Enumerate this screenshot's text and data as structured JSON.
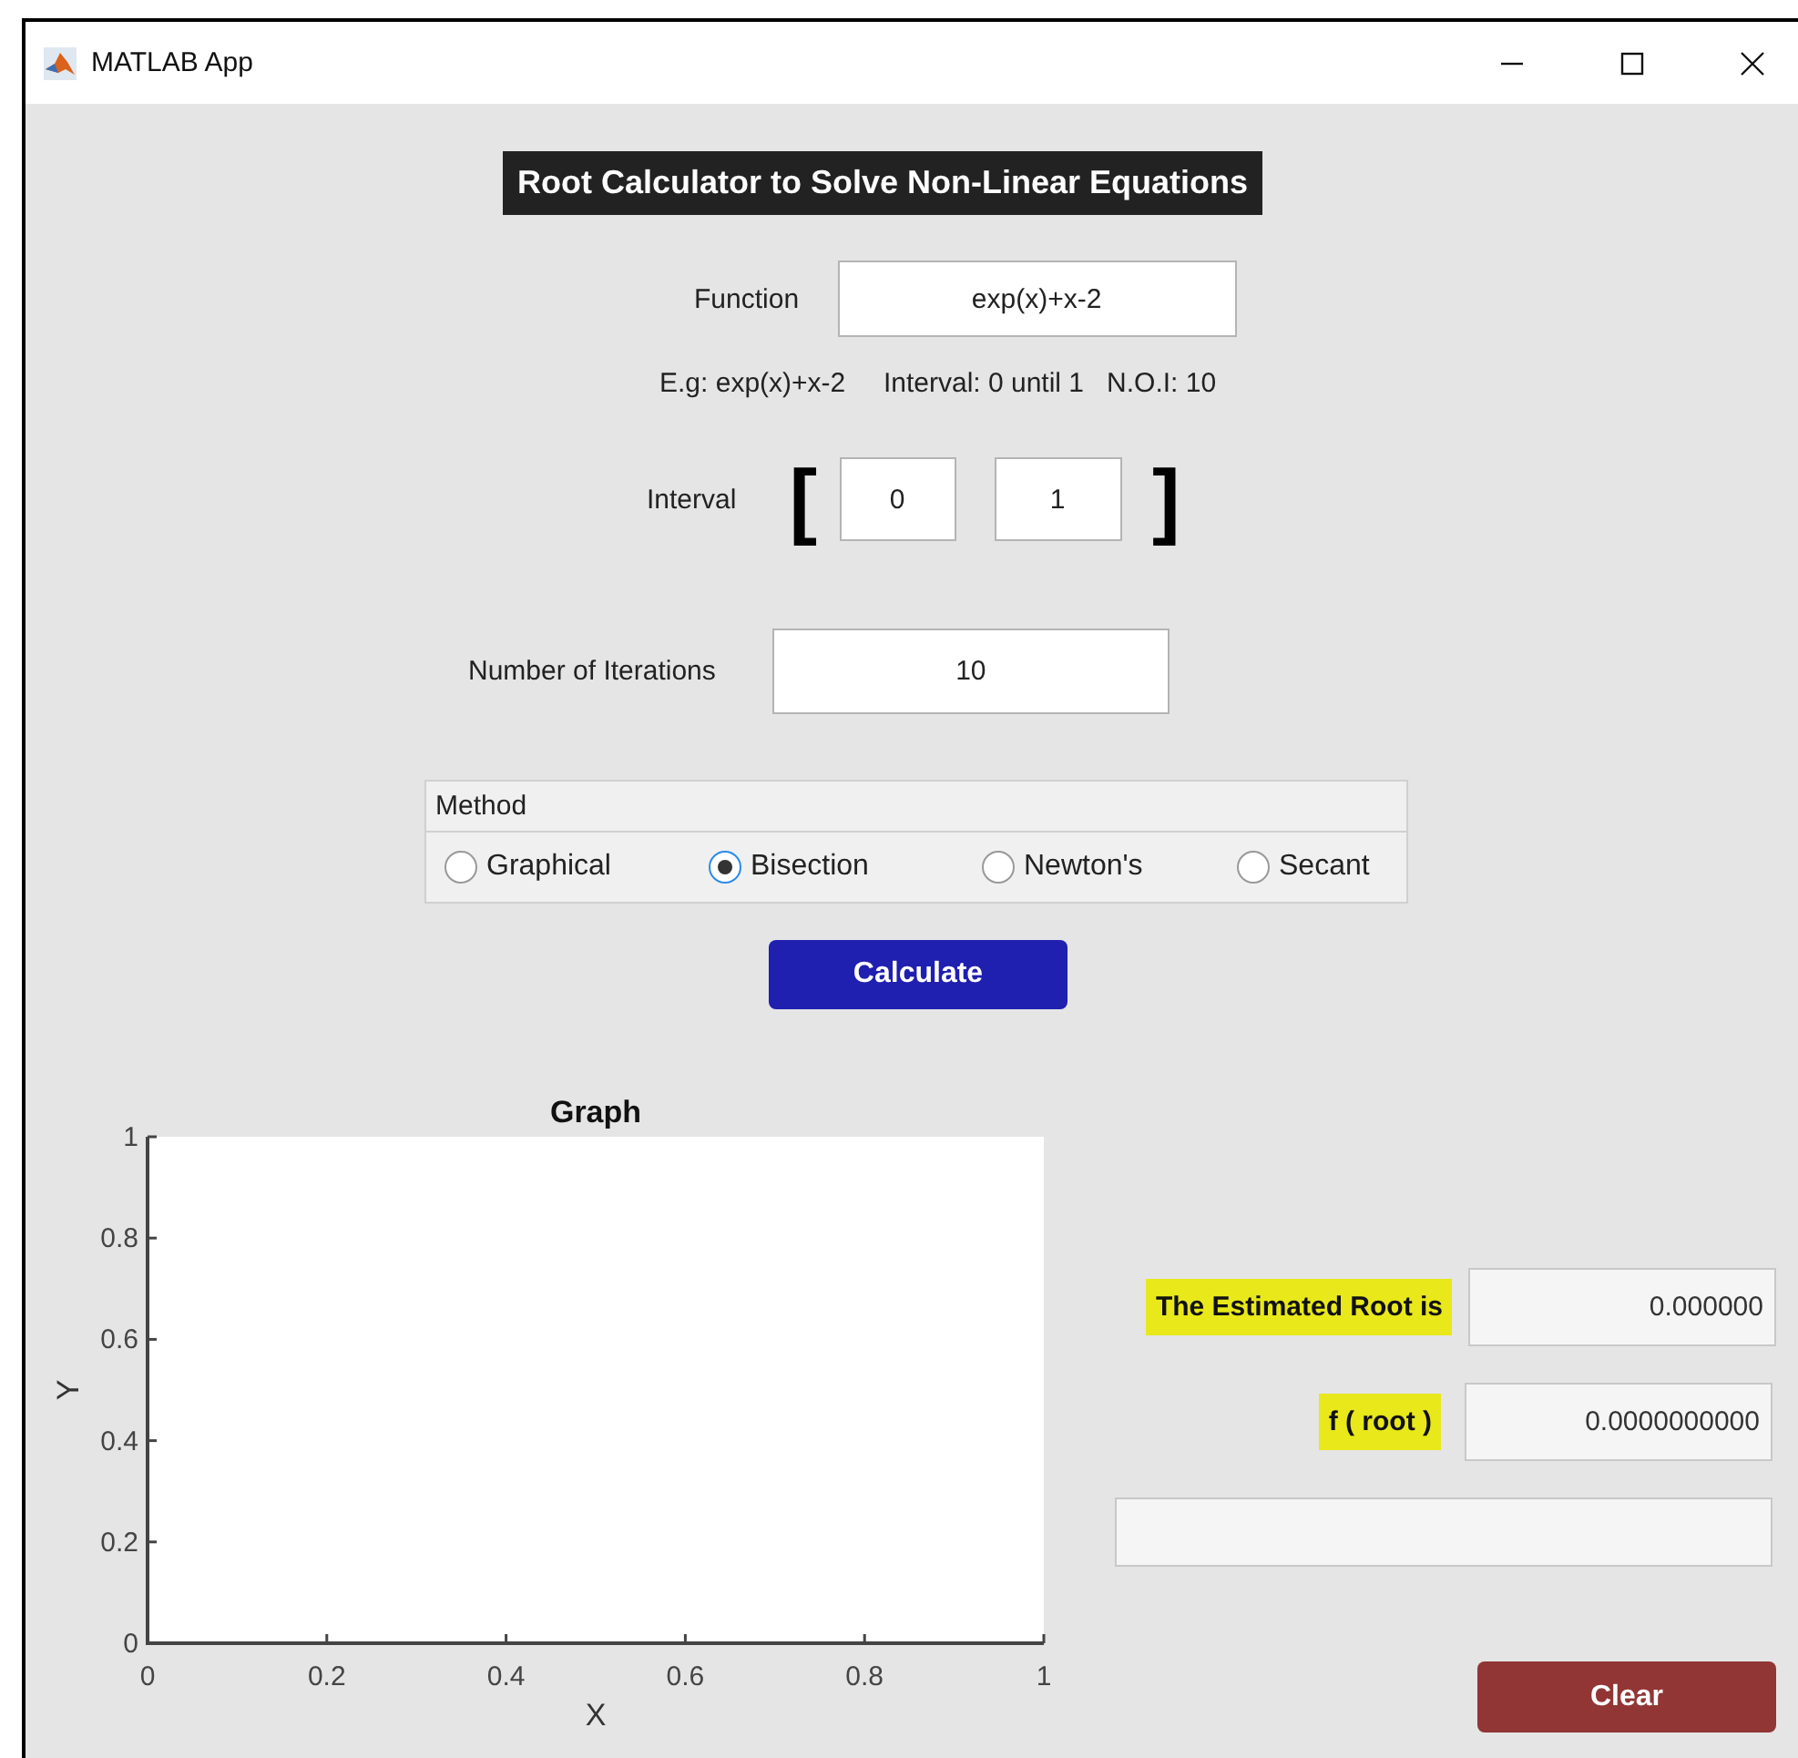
{
  "window": {
    "title": "MATLAB App"
  },
  "heading": "Root Calculator to Solve Non-Linear Equations",
  "function": {
    "label": "Function",
    "value": "exp(x)+x-2"
  },
  "hint": "E.g: exp(x)+x-2     Interval: 0 until 1   N.O.I: 10",
  "interval": {
    "label": "Interval",
    "open": "[",
    "from": "0",
    "to": "1",
    "close": "]"
  },
  "iterations": {
    "label": "Number of Iterations",
    "value": "10"
  },
  "method": {
    "title": "Method",
    "options": [
      {
        "label": "Graphical",
        "selected": false
      },
      {
        "label": "Bisection",
        "selected": true
      },
      {
        "label": "Newton's",
        "selected": false
      },
      {
        "label": "Secant",
        "selected": false
      }
    ]
  },
  "calculate_button": "Calculate",
  "graph": {
    "chart_data": {
      "type": "line",
      "title": "Graph",
      "xlabel": "X",
      "ylabel": "Y",
      "xlim": [
        0,
        1
      ],
      "ylim": [
        0,
        1
      ],
      "xticks": [
        0,
        0.2,
        0.4,
        0.6,
        0.8,
        1
      ],
      "yticks": [
        0,
        0.2,
        0.4,
        0.6,
        0.8,
        1
      ]
    }
  },
  "results": {
    "root_label": "The Estimated Root is",
    "root_value": "0.000000",
    "froot_label": "f ( root )",
    "froot_value": "0.0000000000"
  },
  "clear_button": "Clear"
}
